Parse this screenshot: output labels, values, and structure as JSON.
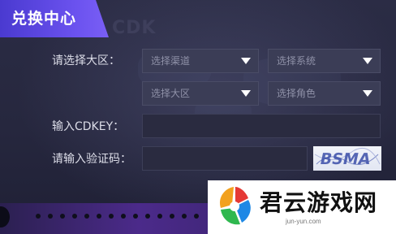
{
  "header": {
    "title": "兑换中心",
    "watermark": "CDK"
  },
  "form": {
    "region_label": "请选择大区：",
    "channel_select": {
      "placeholder": "选择渠道"
    },
    "system_select": {
      "placeholder": "选择系统"
    },
    "zone_select": {
      "placeholder": "选择大区"
    },
    "role_select": {
      "placeholder": "选择角色"
    },
    "cdkey_label": "输入CDKEY：",
    "cdkey_value": "",
    "captcha_label": "请输入验证码：",
    "captcha_value": "",
    "captcha_text": "BSMA"
  },
  "watermark_logo": {
    "name": "君云游戏网",
    "domain": "jun-yun.com"
  },
  "colors": {
    "accent": "#6b52ef",
    "panel_bg": "#2b2c45",
    "select_bg": "#3b3d56"
  }
}
